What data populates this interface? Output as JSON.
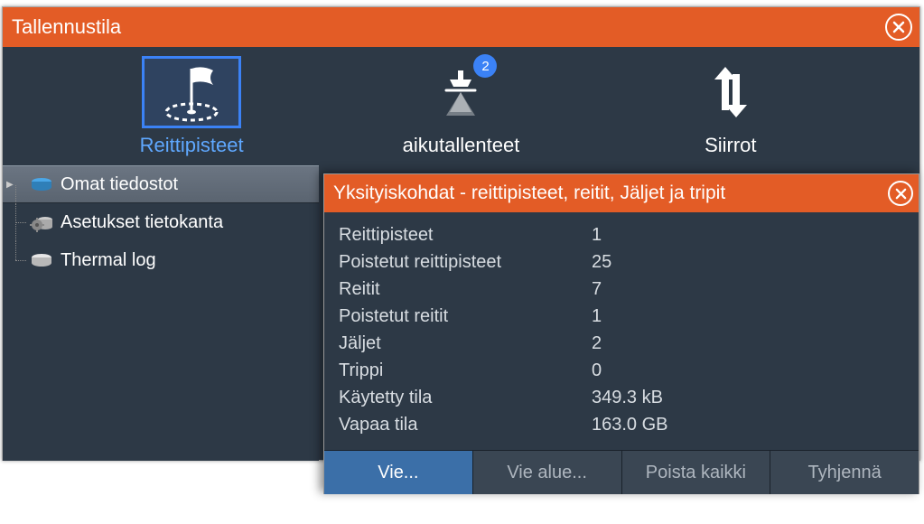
{
  "window": {
    "title": "Tallennustila"
  },
  "tabs": {
    "waypoints": {
      "label": "Reittipisteet"
    },
    "recordings": {
      "label": "aikutallenteet",
      "badge": "2"
    },
    "transfers": {
      "label": "Siirrot"
    }
  },
  "sidebar": {
    "items": [
      {
        "label": "Omat tiedostot"
      },
      {
        "label": "Asetukset tietokanta"
      },
      {
        "label": "Thermal log"
      }
    ]
  },
  "details": {
    "title": "Yksityiskohdat - reittipisteet, reitit, Jäljet ja tripit",
    "rows": [
      {
        "label": "Reittipisteet",
        "value": "1"
      },
      {
        "label": "Poistetut reittipisteet",
        "value": "25"
      },
      {
        "label": "Reitit",
        "value": "7"
      },
      {
        "label": "Poistetut reitit",
        "value": "1"
      },
      {
        "label": "Jäljet",
        "value": "2"
      },
      {
        "label": "Trippi",
        "value": "0"
      },
      {
        "label": "Käytetty tila",
        "value": "349.3 kB"
      },
      {
        "label": "Vapaa tila",
        "value": "163.0 GB"
      }
    ]
  },
  "actions": {
    "export": "Vie...",
    "export_area": "Vie alue...",
    "delete_all": "Poista kaikki",
    "clear": "Tyhjennä"
  }
}
